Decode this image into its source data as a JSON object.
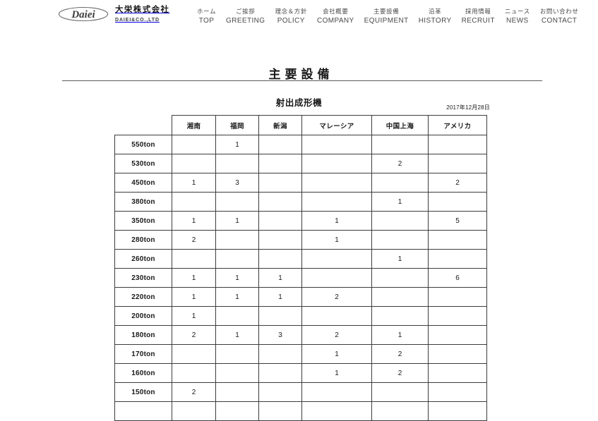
{
  "header": {
    "brand": {
      "logo_icon": "daiei-script-logo",
      "name_jp": "大栄株式会社",
      "name_en": "DAIEI&CO.,LTD"
    },
    "nav": [
      {
        "jp": "ホーム",
        "en": "TOP"
      },
      {
        "jp": "ご挨拶",
        "en": "GREETING"
      },
      {
        "jp": "理念＆方針",
        "en": "POLICY"
      },
      {
        "jp": "会社概要",
        "en": "COMPANY"
      },
      {
        "jp": "主要設備",
        "en": "EQUIPMENT"
      },
      {
        "jp": "沿革",
        "en": "HISTORY"
      },
      {
        "jp": "採用情報",
        "en": "RECRUIT"
      },
      {
        "jp": "ニュース",
        "en": "NEWS"
      },
      {
        "jp": "お問い合わせ",
        "en": "CONTACT"
      }
    ]
  },
  "main": {
    "page_title": "主要設備",
    "section_title": "射出成形機",
    "as_of_date": "2017年12月28日",
    "table": {
      "corner_label": "",
      "columns": [
        "湘南",
        "福岡",
        "新潟",
        "マレーシア",
        "中国上海",
        "アメリカ"
      ],
      "rows": [
        {
          "label": "550ton",
          "values": [
            "",
            "1",
            "",
            "",
            "",
            ""
          ]
        },
        {
          "label": "530ton",
          "values": [
            "",
            "",
            "",
            "",
            "2",
            ""
          ]
        },
        {
          "label": "450ton",
          "values": [
            "1",
            "3",
            "",
            "",
            "",
            "2"
          ]
        },
        {
          "label": "380ton",
          "values": [
            "",
            "",
            "",
            "",
            "1",
            ""
          ]
        },
        {
          "label": "350ton",
          "values": [
            "1",
            "1",
            "",
            "1",
            "",
            "5"
          ]
        },
        {
          "label": "280ton",
          "values": [
            "2",
            "",
            "",
            "1",
            "",
            ""
          ]
        },
        {
          "label": "260ton",
          "values": [
            "",
            "",
            "",
            "",
            "1",
            ""
          ]
        },
        {
          "label": "230ton",
          "values": [
            "1",
            "1",
            "1",
            "",
            "",
            "6"
          ]
        },
        {
          "label": "220ton",
          "values": [
            "1",
            "1",
            "1",
            "2",
            "",
            ""
          ]
        },
        {
          "label": "200ton",
          "values": [
            "1",
            "",
            "",
            "",
            "",
            ""
          ]
        },
        {
          "label": "180ton",
          "values": [
            "2",
            "1",
            "3",
            "2",
            "1",
            ""
          ]
        },
        {
          "label": "170ton",
          "values": [
            "",
            "",
            "",
            "1",
            "2",
            ""
          ]
        },
        {
          "label": "160ton",
          "values": [
            "",
            "",
            "",
            "1",
            "2",
            ""
          ]
        },
        {
          "label": "150ton",
          "values": [
            "2",
            "",
            "",
            "",
            "",
            ""
          ]
        },
        {
          "label": "",
          "values": [
            "",
            "",
            "",
            "",
            "",
            ""
          ]
        }
      ]
    }
  },
  "colors": {
    "text": "#1a1a1a",
    "nav_text": "#4a4a4a",
    "border": "#3c3c3c",
    "rule": "#5c5c5c",
    "background": "#ffffff"
  }
}
